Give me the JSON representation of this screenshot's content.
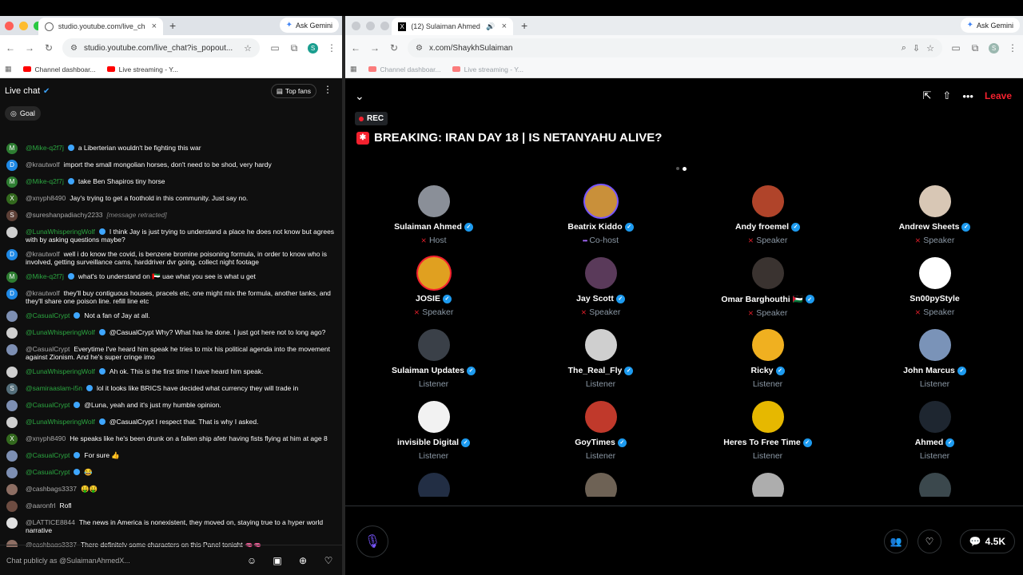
{
  "left_window": {
    "tab_title": "studio.youtube.com/live_chat",
    "gemini_label": "Ask Gemini",
    "url": "studio.youtube.com/live_chat?is_popout...",
    "profile_initial": "S",
    "bookmarks": [
      "Channel dashboar...",
      "Live streaming - Y..."
    ]
  },
  "chat": {
    "title": "Live chat",
    "top_fans": "Top fans",
    "goal": "Goal",
    "input_placeholder": "Chat publicly as @SulaimanAhmedX...",
    "messages": [
      {
        "initial": "M",
        "color": "#2e7d32",
        "author": "@Mike-q2f7j",
        "member": true,
        "text": "a Liberterian wouldn't be fighting this war"
      },
      {
        "initial": "D",
        "color": "#1e88e5",
        "author": "@krautwolf",
        "member": false,
        "text": "import the small mongolian horses, don't need to be shod, very hardy"
      },
      {
        "initial": "M",
        "color": "#2e7d32",
        "author": "@Mike-q2f7j",
        "member": true,
        "text": "take Ben Shapiros tiny horse"
      },
      {
        "initial": "X",
        "color": "#33691e",
        "author": "@xnyph8490",
        "member": false,
        "text": "Jay's trying to get a foothold in this community. Just say no."
      },
      {
        "initial": "S",
        "color": "#5d4037",
        "author": "@sureshanpadiachy2233",
        "member": false,
        "text": "[message retracted]",
        "retracted": true
      },
      {
        "initial": "",
        "color": "#cfcfcf",
        "author": "@LunaWhisperingWolf",
        "member": true,
        "text": "I think Jay is just trying to understand a place he does not know but agrees with by asking questions maybe?"
      },
      {
        "initial": "D",
        "color": "#1e88e5",
        "author": "@krautwolf",
        "member": false,
        "text": "well i do know the covid, is benzene bromine poisoning formula, in order to know who is involved, getting surveillance cams, harddriver dvr going, collect night footage"
      },
      {
        "initial": "M",
        "color": "#2e7d32",
        "author": "@Mike-q2f7j",
        "member": true,
        "text": "what's to understand on 🇦🇪 uae what you see is what u get"
      },
      {
        "initial": "D",
        "color": "#1e88e5",
        "author": "@krautwolf",
        "member": false,
        "text": "they'll buy contiguous houses, pracels etc, one might mix the formula, another tanks, and they'll share one poison line. refill line etc"
      },
      {
        "initial": "",
        "color": "#7d8fb3",
        "author": "@CasualCrypt",
        "member": true,
        "text": "Not a fan of Jay at all."
      },
      {
        "initial": "",
        "color": "#cfcfcf",
        "author": "@LunaWhisperingWolf",
        "member": true,
        "text": "@CasualCrypt Why? What has he done. I just got here not to long ago?"
      },
      {
        "initial": "",
        "color": "#7d8fb3",
        "author": "@CasualCrypt",
        "member": false,
        "text": "Everytime I've heard him speak he tries to mix his political agenda into the movement against Zionism. And he's super cringe imo"
      },
      {
        "initial": "",
        "color": "#cfcfcf",
        "author": "@LunaWhisperingWolf",
        "member": true,
        "text": "Ah ok. This is the first time I have heard him speak."
      },
      {
        "initial": "S",
        "color": "#546e7a",
        "author": "@samiraaslam-i5n",
        "member": true,
        "text": "lol it looks like BRICS have decided what currency they will trade in"
      },
      {
        "initial": "",
        "color": "#7d8fb3",
        "author": "@CasualCrypt",
        "member": true,
        "text": "@Luna, yeah and it's just my humble opinion."
      },
      {
        "initial": "",
        "color": "#cfcfcf",
        "author": "@LunaWhisperingWolf",
        "member": true,
        "text": "@CasualCrypt I respect that. That is why I asked."
      },
      {
        "initial": "X",
        "color": "#33691e",
        "author": "@xnyph8490",
        "member": false,
        "text": "He speaks like he's been drunk on a fallen ship afetr having fists flying at him at age 8"
      },
      {
        "initial": "",
        "color": "#7d8fb3",
        "author": "@CasualCrypt",
        "member": true,
        "text": "For sure 👍"
      },
      {
        "initial": "",
        "color": "#7d8fb3",
        "author": "@CasualCrypt",
        "member": true,
        "text": "😂"
      },
      {
        "initial": "",
        "color": "#8d6e63",
        "author": "@cashbags3337",
        "member": false,
        "text": "🤑🤑"
      },
      {
        "initial": "",
        "color": "#6d4c41",
        "author": "@aaronfrl",
        "member": false,
        "text": "Rofl"
      },
      {
        "initial": "",
        "color": "#e0e0e0",
        "author": "@LATTICE8844",
        "member": false,
        "text": "The news in America is nonexistent, they moved on, staying true to a hyper world narrative"
      },
      {
        "initial": "",
        "color": "#8d6e63",
        "author": "@cashbags3337",
        "member": false,
        "text": "There definitely some characters on this Panel tonight 🫦🫦"
      }
    ]
  },
  "right_window": {
    "tab_title": "(12) Sulaiman Ahmed (@S",
    "gemini_label": "Ask Gemini",
    "url": "x.com/ShaykhSulaiman",
    "profile_initial": "S",
    "bookmarks": [
      "Channel dashboar...",
      "Live streaming - Y..."
    ]
  },
  "space": {
    "leave": "Leave",
    "rec": "REC",
    "title": "BREAKING: IRAN DAY 18 | IS NETANYAHU ALIVE?",
    "listener_count": "4.5K",
    "colors": {
      "accent": "#1d9bf0",
      "leave": "#f4212e",
      "mic": "#7856ff"
    },
    "participants": [
      {
        "name": "Sulaiman Ahmed",
        "role": "Host",
        "verified": true,
        "muted": true,
        "avatar": "#8a8f98"
      },
      {
        "name": "Beatrix Kiddo",
        "role": "Co-host",
        "verified": true,
        "muted": false,
        "speaking": true,
        "avatar": "#c9903a"
      },
      {
        "name": "Andy froemel",
        "role": "Speaker",
        "verified": true,
        "muted": true,
        "avatar": "#b0442a"
      },
      {
        "name": "Andrew Sheets",
        "role": "Speaker",
        "verified": true,
        "muted": true,
        "avatar": "#d8c7b5"
      },
      {
        "name": "JOSIE",
        "role": "Speaker",
        "verified": true,
        "muted": true,
        "avatar": "#e0a020"
      },
      {
        "name": "Jay Scott",
        "role": "Speaker",
        "verified": true,
        "muted": true,
        "avatar": "#5a3a5a"
      },
      {
        "name": "Omar Barghouthi 🇵🇸",
        "role": "Speaker",
        "verified": true,
        "muted": true,
        "avatar": "#3a3330"
      },
      {
        "name": "Sn00pyStyle",
        "role": "Speaker",
        "verified": false,
        "muted": true,
        "avatar": "#ffffff"
      },
      {
        "name": "Sulaiman Updates",
        "role": "Listener",
        "verified": true,
        "muted": false,
        "avatar": "#3a4048"
      },
      {
        "name": "The_Real_Fly",
        "role": "Listener",
        "verified": true,
        "muted": false,
        "avatar": "#cfcfcf"
      },
      {
        "name": "Ricky",
        "role": "Listener",
        "verified": true,
        "muted": false,
        "avatar": "#f0b020"
      },
      {
        "name": "John Marcus",
        "role": "Listener",
        "verified": true,
        "muted": false,
        "avatar": "#7a93b8"
      },
      {
        "name": "invisible Digital",
        "role": "Listener",
        "verified": true,
        "muted": false,
        "avatar": "#f2f2f2"
      },
      {
        "name": "GoyTimes",
        "role": "Listener",
        "verified": true,
        "muted": false,
        "avatar": "#c0392b"
      },
      {
        "name": "Heres To Free Time",
        "role": "Listener",
        "verified": true,
        "muted": false,
        "avatar": "#e6b800"
      },
      {
        "name": "Ahmed",
        "role": "Listener",
        "verified": true,
        "muted": false,
        "avatar": "#1e2630"
      }
    ],
    "partial_avatars": [
      "#2a3a55",
      "#8a7a6a",
      "#d8d8d8",
      "#4a5a60"
    ]
  }
}
